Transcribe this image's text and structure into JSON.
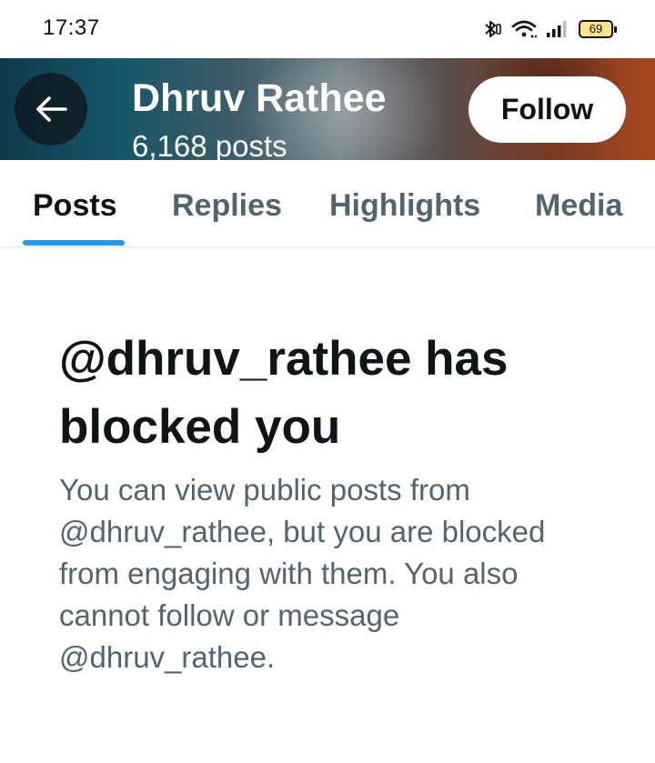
{
  "status_bar": {
    "time": "17:37",
    "battery": "69",
    "icons": [
      "bluetooth-icon",
      "wifi-icon",
      "signal-icon",
      "battery-icon"
    ]
  },
  "header": {
    "name": "Dhruv Rathee",
    "posts": "6,168 posts",
    "follow_label": "Follow",
    "back_icon": "arrow-left-icon"
  },
  "tabs": [
    {
      "label": "Posts",
      "active": true
    },
    {
      "label": "Replies",
      "active": false
    },
    {
      "label": "Highlights",
      "active": false
    },
    {
      "label": "Media",
      "active": false
    }
  ],
  "blocked": {
    "title": "@dhruv_rathee has blocked you",
    "message": "You can view public posts from @dhruv_rathee, but you are blocked from engaging with them. You also cannot follow or message @dhruv_rathee."
  },
  "colors": {
    "accent": "#1d9bf0",
    "text_primary": "#0f1419",
    "text_secondary": "#536471"
  }
}
